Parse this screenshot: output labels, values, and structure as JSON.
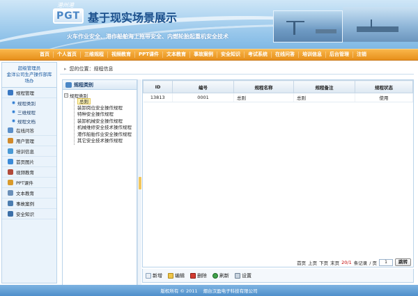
{
  "banner": {
    "logo_small": "港州港",
    "logo_text": "PGT",
    "title": "基于现实场景展示",
    "subtitle": "火车作业安全、港作船舶海上拖带安全、内燃轮胎起重机安全技术"
  },
  "nav": [
    "首页",
    "个人首页",
    "三维规程",
    "视频教育",
    "PPT课件",
    "文本教育",
    "事故案例",
    "安全知识",
    "考试系统",
    "在线问答",
    "培训信息",
    "后台管理",
    "注销"
  ],
  "sidebar": {
    "welcome": [
      "超级管理员",
      "金洋公司生产操作部库",
      "场办"
    ],
    "group_label": "规程管理",
    "sub_items": [
      "规程类别",
      "三维规程",
      "规程文档"
    ],
    "items": [
      "在线问答",
      "用户管理",
      "培训信息",
      "首页图片",
      "视频教育",
      "PPT课件",
      "文本教育",
      "事故案例",
      "安全知识"
    ],
    "icon_colors": [
      "#3a78c2",
      "#5b8fc9",
      "#d28a2a",
      "#4a9ad6",
      "#3c8bd8",
      "#b24a3a",
      "#d99a2b",
      "#6a8fb8",
      "#4c7db0",
      "#3b6fa8"
    ]
  },
  "breadcrumb": {
    "prefix": "您的位置：",
    "current": "规程信息"
  },
  "tree": {
    "header": "规程类别",
    "root": "规程类别",
    "selected": "总则",
    "nodes": [
      "装卸岗位安全操作规程",
      "特种安全操作规程",
      "装卸机械安全操作规程",
      "机械维修安全技术操作规程",
      "港作船舶作业安全操作规程",
      "其它安全技术操作规程"
    ]
  },
  "grid": {
    "columns": [
      "ID",
      "编号",
      "规程名称",
      "规程备注",
      "规程状态"
    ],
    "rows": [
      {
        "id": "13813",
        "code": "0001",
        "name": "总则",
        "remark": "总则",
        "status": "使用"
      }
    ]
  },
  "pager": {
    "first": "首页",
    "prev": "上页",
    "next": "下页",
    "last": "末页",
    "count": "20/1",
    "count_suffix": "条记录",
    "page_sep": "/ 页",
    "page_value": "1",
    "go": "跳转"
  },
  "toolbar": {
    "add": "新增",
    "edit": "编辑",
    "delete": "删除",
    "refresh": "刷新",
    "settings": "设置"
  },
  "footer": {
    "left": "版权所有 © 2011",
    "right": "烟台汉盈电子科技有限公司"
  }
}
